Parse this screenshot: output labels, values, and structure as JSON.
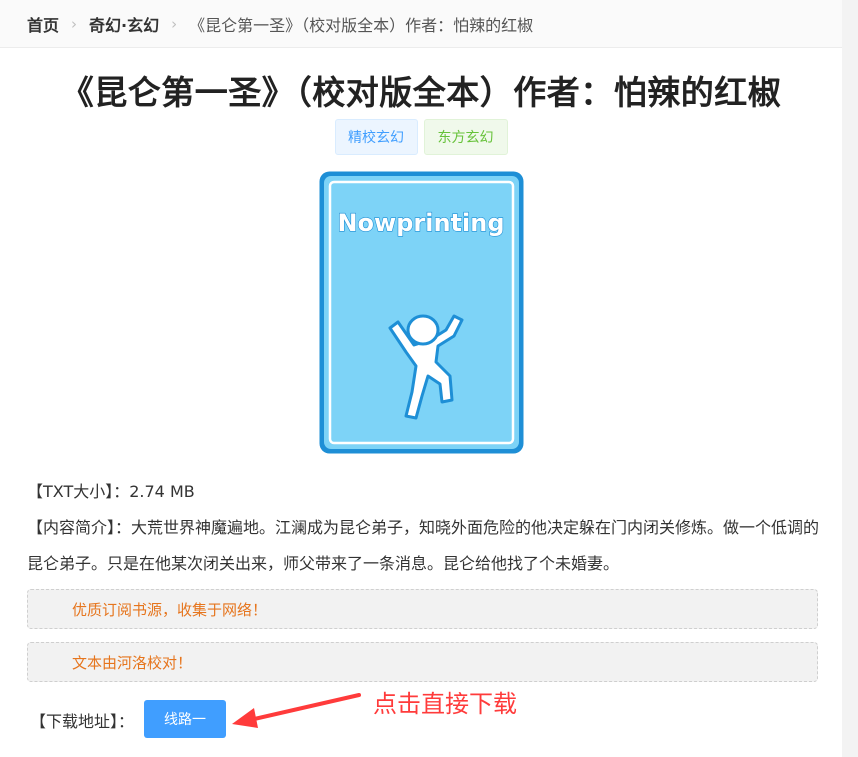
{
  "breadcrumb": {
    "home": "首页",
    "category": "奇幻·玄幻",
    "current": "《昆仑第一圣》（校对版全本）作者：怕辣的红椒"
  },
  "book": {
    "title": "《昆仑第一圣》（校对版全本）作者：怕辣的红椒",
    "tags": [
      "精校玄幻",
      "东方玄幻"
    ],
    "cover_text": "Nowprinting",
    "size_label": "【TXT大小】：",
    "size_value": "2.74 MB",
    "intro_label": "【内容简介】：",
    "intro_text": "大荒世界神魔遍地。江澜成为昆仑弟子，知晓外面危险的他决定躲在门内闭关修炼。做一个低调的昆仑弟子。只是在他某次闭关出来，师父带来了一条消息。昆仑给他找了个未婚妻。"
  },
  "notices": [
    "优质订阅书源，收集于网络！",
    "文本由河洛校对！"
  ],
  "download": {
    "label": "【下载地址】：",
    "button": "线路一",
    "annotation": "点击直接下载"
  },
  "colors": {
    "accent": "#409eff",
    "notice_text": "#e6751d",
    "annotation": "#ff3b3b",
    "cover_fill": "#7dd3f7"
  }
}
